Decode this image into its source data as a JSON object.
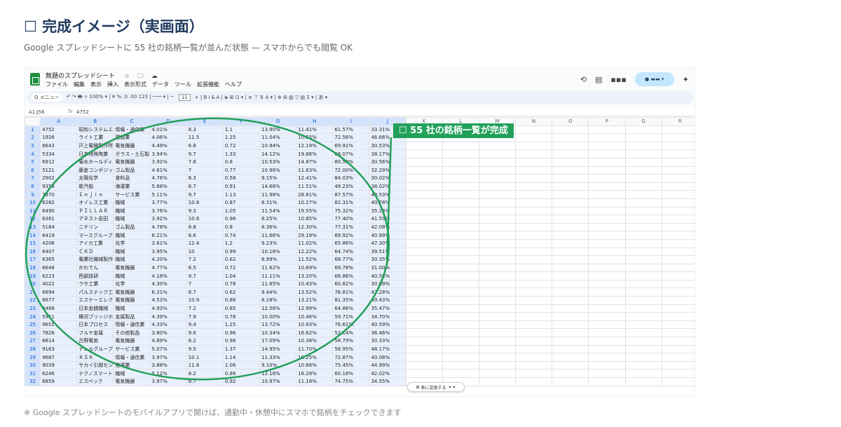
{
  "heading": {
    "title": "☐ 完成イメージ（実画面）",
    "subtitle": "Google スプレッドシートに 55 社の銘柄一覧が並んだ状態 — スマホからでも閲覧 OK"
  },
  "sheet": {
    "title": "無題のスプレッドシート",
    "title_icons": "☆ 🗀 ☁",
    "menu": [
      "ファイル",
      "編集",
      "表示",
      "挿入",
      "表示形式",
      "データ",
      "ツール",
      "拡張機能",
      "ヘルプ"
    ],
    "toolbar": {
      "search": "Q メニュー",
      "items_left": "↶ ↷ 🖶 ⌖ 100% ▾ | ¥ % .0 .00 123 | ─── ▾ | −",
      "font_size": "11",
      "items_right": "+ | B I S̶ A | ◈ ⊞ ⊡ ▾ | ≡ ⊤ ⇅ A ▾ | ⊕ ⊞ ▥ ▽ ▤ Σ ▾ | あ ▾"
    },
    "name_box": "A1:J56",
    "formula_value": "4752",
    "columns": [
      "A",
      "B",
      "C",
      "D",
      "E",
      "F",
      "G",
      "H",
      "I",
      "J",
      "K",
      "L",
      "M",
      "N",
      "O",
      "P",
      "Q",
      "R"
    ],
    "rows": [
      [
        "4752",
        "昭和システムエ",
        "情報・通信業",
        "4.01%",
        "8.3",
        "1.1",
        "13.90%",
        "11.41%",
        "61.57%",
        "33.31%"
      ],
      [
        "1926",
        "ライト工業",
        "建設業",
        "4.06%",
        "11.5",
        "1.25",
        "11.04%",
        "10.55%",
        "72.56%",
        "46.66%"
      ],
      [
        "6643",
        "戸上電機製作所",
        "電気機器",
        "4.49%",
        "6.8",
        "0.72",
        "10.94%",
        "12.19%",
        "69.91%",
        "30.53%"
      ],
      [
        "5334",
        "日本特殊陶業",
        "ガラス・土石製",
        "3.94%",
        "9.7",
        "1.33",
        "14.12%",
        "19.86%",
        "68.07%",
        "38.17%"
      ],
      [
        "6912",
        "菊水ホールディ",
        "電気機器",
        "3.92%",
        "7.8",
        "0.8",
        "10.53%",
        "14.87%",
        "80.59%",
        "30.56%"
      ],
      [
        "5121",
        "藤倉コンポジット",
        "ゴム製品",
        "4.61%",
        "7",
        "0.77",
        "10.96%",
        "11.63%",
        "72.00%",
        "32.29%"
      ],
      [
        "2902",
        "太陽化学",
        "食料品",
        "4.76%",
        "6.3",
        "0.58",
        "9.15%",
        "12.41%",
        "84.03%",
        "30.02%"
      ],
      [
        "9358",
        "乾汽船",
        "海運業",
        "5.68%",
        "6.7",
        "0.91",
        "14.66%",
        "11.51%",
        "49.23%",
        "38.02%"
      ],
      [
        "7370",
        "Ｅｎｊｉｎ",
        "サービス業",
        "5.11%",
        "9.7",
        "1.13",
        "11.98%",
        "28.81%",
        "87.57%",
        "49.53%"
      ],
      [
        "6282",
        "オイレス工業",
        "機械",
        "3.77%",
        "10.8",
        "0.87",
        "8.31%",
        "10.27%",
        "82.31%",
        "40.78%"
      ],
      [
        "6490",
        "ＰＩＬＬＡＲ",
        "機械",
        "3.76%",
        "9.3",
        "1.05",
        "11.54%",
        "19.55%",
        "75.32%",
        "35.13%"
      ],
      [
        "6381",
        "アネスト岩田",
        "機械",
        "3.92%",
        "10.6",
        "0.96",
        "8.25%",
        "10.85%",
        "77.40%",
        "41.59%"
      ],
      [
        "5184",
        "ニチリン",
        "ゴム製品",
        "4.78%",
        "8.8",
        "0.8",
        "8.36%",
        "12.30%",
        "77.31%",
        "42.08%"
      ],
      [
        "6419",
        "マースグループ",
        "機械",
        "6.21%",
        "6.6",
        "0.74",
        "11.66%",
        "29.19%",
        "89.92%",
        "40.99%"
      ],
      [
        "4206",
        "アイカ工業",
        "化学",
        "3.81%",
        "12.4",
        "1.2",
        "9.23%",
        "11.02%",
        "65.86%",
        "47.30%"
      ],
      [
        "6407",
        "ＣＫＤ",
        "機械",
        "3.95%",
        "10",
        "0.99",
        "10.18%",
        "12.22%",
        "64.74%",
        "39.51%"
      ],
      [
        "6365",
        "電業社機械製作",
        "機械",
        "4.20%",
        "7.2",
        "0.62",
        "8.99%",
        "11.52%",
        "68.77%",
        "30.35%"
      ],
      [
        "6648",
        "かわでん",
        "電気機器",
        "4.77%",
        "6.5",
        "0.72",
        "11.62%",
        "10.69%",
        "69.78%",
        "31.00%"
      ],
      [
        "6223",
        "西部技研",
        "機械",
        "4.18%",
        "9.7",
        "1.04",
        "11.11%",
        "13.20%",
        "66.86%",
        "40.58%"
      ],
      [
        "4022",
        "ラサ工業",
        "化学",
        "4.30%",
        "7",
        "0.78",
        "11.85%",
        "10.43%",
        "60.82%",
        "30.09%"
      ],
      [
        "6894",
        "パルステック工",
        "電気機器",
        "6.31%",
        "6.7",
        "0.62",
        "9.44%",
        "13.52%",
        "76.81%",
        "42.28%"
      ],
      [
        "6677",
        "エスケーエレク",
        "電気機器",
        "4.53%",
        "10.9",
        "0.86",
        "8.18%",
        "13.21%",
        "81.35%",
        "49.43%"
      ],
      [
        "6488",
        "日本金銭機械",
        "機械",
        "4.93%",
        "7.2",
        "0.85",
        "12.56%",
        "12.99%",
        "64.86%",
        "35.47%"
      ],
      [
        "5911",
        "横河ブリッジホ",
        "金属製品",
        "4.39%",
        "7.9",
        "0.78",
        "10.00%",
        "10.46%",
        "59.71%",
        "34.70%"
      ],
      [
        "9651",
        "日本プロセス",
        "情報・通信業",
        "4.33%",
        "9.4",
        "1.25",
        "13.72%",
        "10.93%",
        "76.61%",
        "40.59%"
      ],
      [
        "7826",
        "フルヤ金属",
        "その他製品",
        "3.80%",
        "9.6",
        "0.96",
        "10.34%",
        "16.62%",
        "52.14%",
        "36.46%"
      ],
      [
        "6814",
        "古野電気",
        "電気機器",
        "4.89%",
        "6.2",
        "0.98",
        "17.09%",
        "10.38%",
        "58.79%",
        "30.33%"
      ],
      [
        "9163",
        "ナレルグループ",
        "サービス業",
        "5.07%",
        "9.5",
        "1.37",
        "14.95%",
        "11.70%",
        "58.95%",
        "48.17%"
      ],
      [
        "9687",
        "ＫＳＫ",
        "情報・通信業",
        "3.97%",
        "10.1",
        "1.14",
        "11.33%",
        "10.25%",
        "72.87%",
        "40.08%"
      ],
      [
        "9039",
        "サカイ引越セン",
        "陸運業",
        "3.88%",
        "11.6",
        "1.06",
        "9.10%",
        "10.68%",
        "75.45%",
        "44.99%"
      ],
      [
        "6246",
        "テクノスマート",
        "機械",
        "5.12%",
        "8.2",
        "0.86",
        "12.16%",
        "16.28%",
        "60.18%",
        "42.02%"
      ],
      [
        "6859",
        "エスペック",
        "電気機器",
        "3.97%",
        "8.7",
        "0.92",
        "10.97%",
        "11.18%",
        "74.75%",
        "34.55%"
      ]
    ],
    "convert_button": "表に変換する",
    "convert_suffix": "▾ ✕"
  },
  "annotation": {
    "callout": "☐ 55 社の銘柄一覧が完成",
    "color": "#22a05a"
  },
  "footnote": "※ Google スプレッドシートのモバイルアプリで開けば、通勤中・休憩中にスマホで銘柄をチェックできます"
}
